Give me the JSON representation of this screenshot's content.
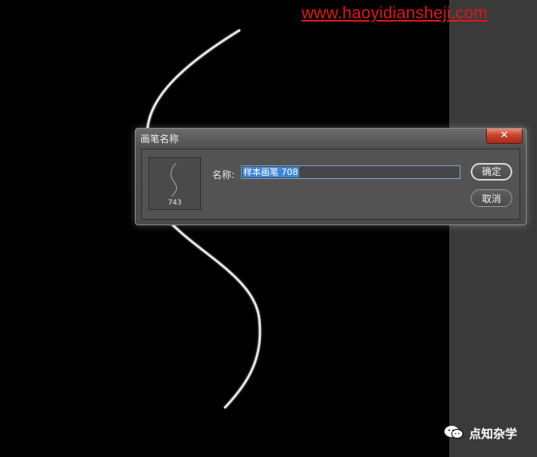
{
  "watermark": "www.haoyidiansheji.com",
  "dialog": {
    "title": "画笔名称",
    "close_label": "✕",
    "preview_number": "743",
    "name_label": "名称:",
    "name_value": "样本画笔 708",
    "ok_label": "确定",
    "cancel_label": "取消"
  },
  "brand": {
    "text": "点知杂学",
    "icon": "wechat-icon"
  },
  "colors": {
    "canvas": "#000000",
    "watermark": "#e01818",
    "selection": "#3d86d8",
    "close_button": "#c9432e"
  }
}
